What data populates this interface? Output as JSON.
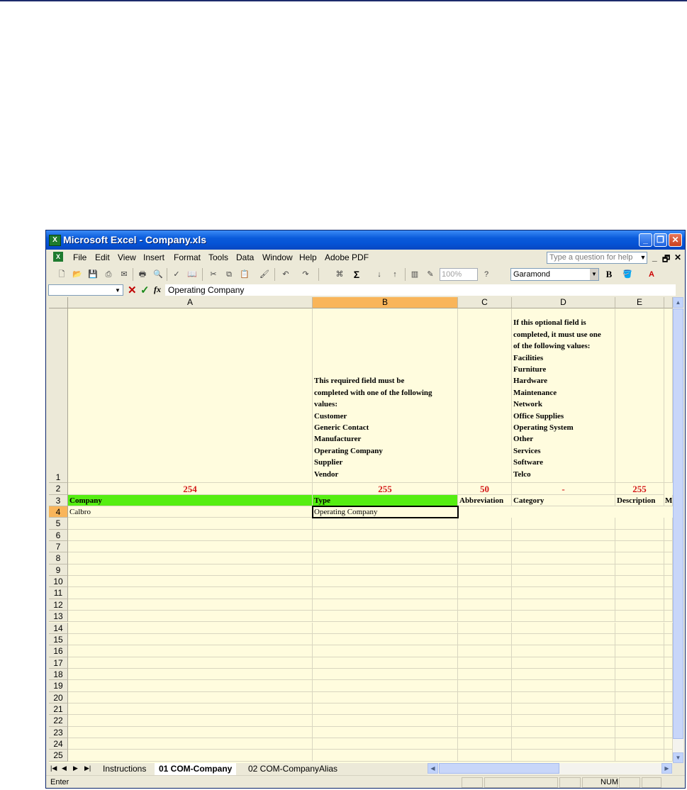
{
  "window": {
    "title": "Microsoft Excel - Company.xls",
    "icon": "excel-icon",
    "controls": [
      "_",
      "❐",
      "✕"
    ]
  },
  "menubar": {
    "items": [
      "File",
      "Edit",
      "View",
      "Insert",
      "Format",
      "Tools",
      "Data",
      "Window",
      "Help",
      "Adobe PDF"
    ],
    "help_placeholder": "Type a question for help",
    "mdi_controls": [
      "_",
      "🗗",
      "✕"
    ]
  },
  "toolbar": {
    "zoom": "100%",
    "font": "Garamond",
    "bold": "B",
    "autosum": "Σ"
  },
  "formula_bar": {
    "name_box": "",
    "cancel": "✕",
    "enter": "✓",
    "fx": "fx",
    "content": "Operating Company"
  },
  "sheet": {
    "columns": [
      "A",
      "B",
      "C",
      "D",
      "E"
    ],
    "selected_column": "B",
    "active_cell": "B4",
    "rows": [
      "1",
      "2",
      "3",
      "4",
      "5",
      "6",
      "7",
      "8",
      "9",
      "10",
      "11",
      "12",
      "13",
      "14",
      "15",
      "16",
      "17",
      "18",
      "19",
      "20",
      "21",
      "22",
      "23",
      "24",
      "25"
    ],
    "notes": {
      "b1": [
        "This required field must be",
        "completed with one of the following",
        "values:",
        "Customer",
        "Generic Contact",
        "Manufacturer",
        "Operating Company",
        "Supplier",
        "Vendor"
      ],
      "d1": [
        "If this optional field is",
        "completed, it must use one",
        "of the following values:",
        "Facilities",
        "Furniture",
        "Hardware",
        "Maintenance",
        "Network",
        "Office Supplies",
        "Operating System",
        "Other",
        "Services",
        "Software",
        "Telco"
      ]
    },
    "lengths": {
      "a": "254",
      "b": "255",
      "c": "50",
      "d": "-",
      "e": "255"
    },
    "headers": {
      "a": "Company",
      "b": "Type",
      "c": "Abbreviation",
      "d": "Category",
      "e": "Description",
      "f": "M"
    },
    "row4": {
      "a": "Calbro",
      "b": "Operating Company"
    }
  },
  "tabs": {
    "items": [
      "Instructions",
      "01 COM-Company",
      "02 COM-CompanyAlias"
    ],
    "active": "01 COM-Company"
  },
  "status": {
    "mode": "Enter",
    "num": "NUM"
  }
}
